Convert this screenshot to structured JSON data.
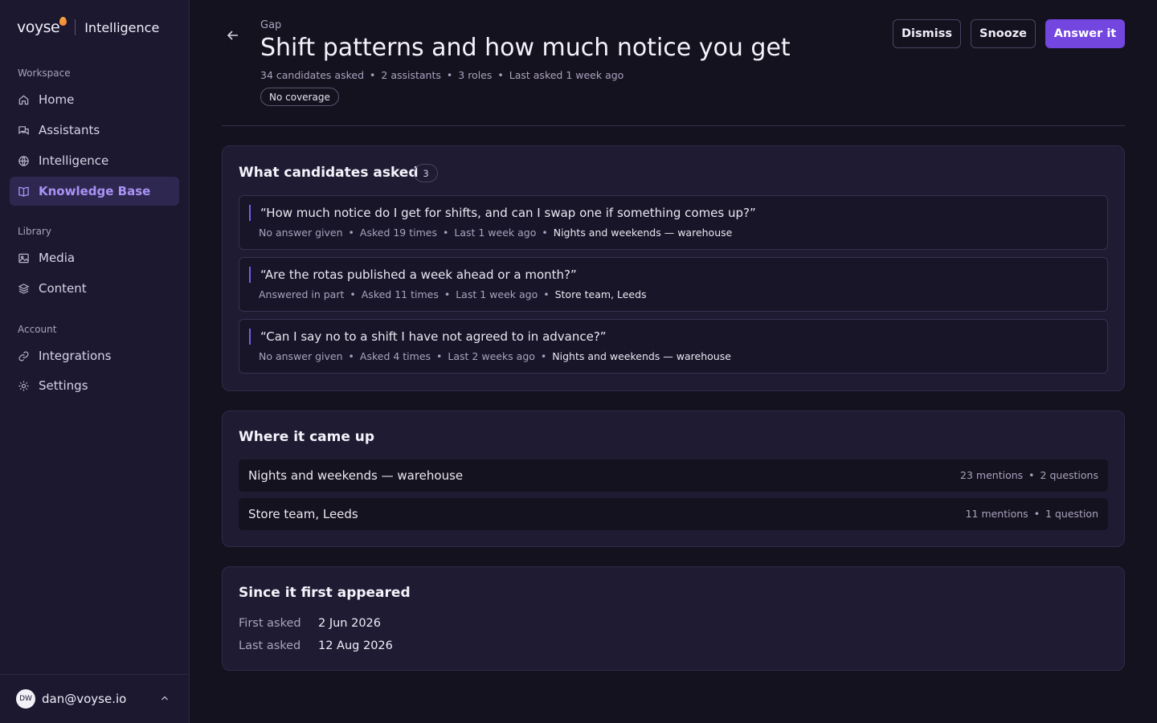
{
  "brand": {
    "logo": "voyse",
    "product": "Intelligence"
  },
  "sidebar": {
    "sections": {
      "workspace": "Workspace",
      "library": "Library",
      "account": "Account"
    },
    "items": {
      "home": "Home",
      "assistants": "Assistants",
      "intelligence": "Intelligence",
      "knowledge_base": "Knowledge Base",
      "media": "Media",
      "content": "Content",
      "integrations": "Integrations",
      "settings": "Settings"
    },
    "active": "knowledge_base",
    "user": {
      "initials": "DW",
      "email": "dan@voyse.io"
    }
  },
  "header": {
    "eyebrow": "Gap",
    "title": "Shift patterns and how much notice you get",
    "meta": [
      "34 candidates asked",
      "2 assistants",
      "3 roles",
      "Last asked 1 week ago"
    ],
    "status_pill": "No coverage",
    "actions": {
      "dismiss": "Dismiss",
      "snooze": "Snooze",
      "answer": "Answer it"
    }
  },
  "asked": {
    "title": "What candidates asked",
    "count": "3",
    "questions": [
      {
        "text": "“How much notice do I get for shifts, and can I swap one if something comes up?”",
        "status": "No answer given",
        "times": "Asked 19 times",
        "last": "Last 1 week ago",
        "role": "Nights and weekends — warehouse"
      },
      {
        "text": "“Are the rotas published a week ahead or a month?”",
        "status": "Answered in part",
        "times": "Asked 11 times",
        "last": "Last 1 week ago",
        "role": "Store team, Leeds"
      },
      {
        "text": "“Can I say no to a shift I have not agreed to in advance?”",
        "status": "No answer given",
        "times": "Asked 4 times",
        "last": "Last 2 weeks ago",
        "role": "Nights and weekends — warehouse"
      }
    ]
  },
  "places": {
    "title": "Where it came up",
    "rows": [
      {
        "name": "Nights and weekends — warehouse",
        "mentions": "23 mentions",
        "questions": "2 questions"
      },
      {
        "name": "Store team, Leeds",
        "mentions": "11 mentions",
        "questions": "1 question"
      }
    ]
  },
  "timeline": {
    "title": "Since it first appeared",
    "first_label": "First asked",
    "first_value": "2 Jun 2026",
    "last_label": "Last asked",
    "last_value": "12 Aug 2026"
  },
  "colors": {
    "accent": "#7446e0",
    "active_nav": "#a993f5",
    "quote_bar": "#7a5ce8"
  },
  "icons": [
    "home-icon",
    "chat-icon",
    "globe-icon",
    "book-icon",
    "image-icon",
    "layers-icon",
    "link-icon",
    "gear-icon",
    "back-arrow-icon",
    "chevron-up-icon"
  ]
}
